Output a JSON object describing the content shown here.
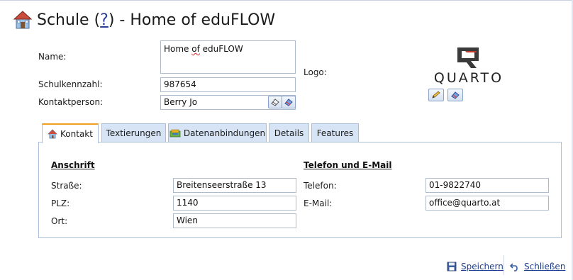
{
  "header": {
    "title_prefix": "Schule (",
    "help_link": "?",
    "title_suffix": ") - Home of eduFLOW"
  },
  "form": {
    "name_label": "Name:",
    "name_value": "Home of eduFLOW",
    "name_value_first": "Home ",
    "name_value_misspelled": "of",
    "name_value_rest": " eduFLOW",
    "schulkennzahl_label": "Schulkennzahl:",
    "schulkennzahl_value": "987654",
    "kontakt_label": "Kontaktperson:",
    "kontakt_value": "Berry Jo",
    "logo_label": "Logo:",
    "logo_text": "QUARTO"
  },
  "tabs": [
    {
      "label": "Kontakt",
      "icon": "house-icon",
      "active": true
    },
    {
      "label": "Textierungen",
      "active": false
    },
    {
      "label": "Datenanbindungen",
      "icon": "database-icon",
      "active": false
    },
    {
      "label": "Details",
      "active": false
    },
    {
      "label": "Features",
      "active": false
    }
  ],
  "kontakt": {
    "anschrift_title": "Anschrift",
    "strasse_label": "Straße:",
    "strasse_value": "Breitenseerstraße 13",
    "plz_label": "PLZ:",
    "plz_value": "1140",
    "ort_label": "Ort:",
    "ort_value": "Wien",
    "telefon_title": "Telefon und E-Mail",
    "telefon_label": "Telefon:",
    "telefon_value": "01-9822740",
    "email_label": "E-Mail:",
    "email_value": "office@quarto.at"
  },
  "footer": {
    "save_label": "Speichern",
    "close_label": "Schließen"
  },
  "colors": {
    "accent_tab_top": "#f0a020",
    "tab_bg": "#d6e4f5",
    "link": "#1d3d8f",
    "border": "#a9bfd9"
  }
}
